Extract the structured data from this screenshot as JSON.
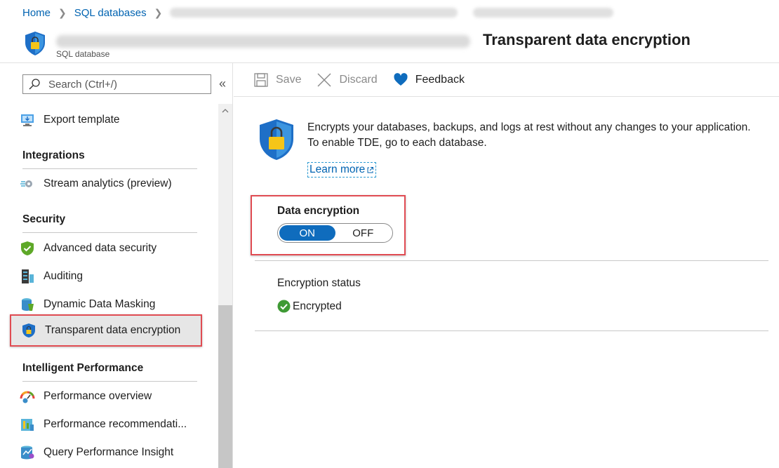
{
  "breadcrumb": {
    "home": "Home",
    "sql_databases": "SQL databases"
  },
  "title": {
    "heading": "Transparent data encryption",
    "subtitle": "SQL database"
  },
  "sidebar": {
    "search_placeholder": "Search (Ctrl+/)",
    "collapse_glyph": "«",
    "items": {
      "export_template": "Export template",
      "integrations_header": "Integrations",
      "stream_analytics": "Stream analytics (preview)",
      "security_header": "Security",
      "advanced_data_security": "Advanced data security",
      "auditing": "Auditing",
      "dynamic_data_masking": "Dynamic Data Masking",
      "transparent_data_encryption": "Transparent data encryption",
      "intelligent_performance_header": "Intelligent Performance",
      "performance_overview": "Performance overview",
      "performance_recommendations": "Performance recommendati...",
      "query_performance_insight": "Query Performance Insight"
    }
  },
  "toolbar": {
    "save": "Save",
    "discard": "Discard",
    "feedback": "Feedback"
  },
  "content": {
    "info_line1": "Encrypts your databases, backups, and logs at rest without any changes to your application.",
    "info_line2": "To enable TDE, go to each database.",
    "learn_more": "Learn more",
    "data_encryption_label": "Data encryption",
    "toggle_on": "ON",
    "toggle_off": "OFF",
    "toggle_selected": "ON",
    "encryption_status_label": "Encryption status",
    "encryption_status_value": "Encrypted"
  },
  "colors": {
    "link": "#0063b1",
    "accent": "#0f6cbd",
    "highlight_border": "#e04b52",
    "success": "#3f9a35"
  }
}
